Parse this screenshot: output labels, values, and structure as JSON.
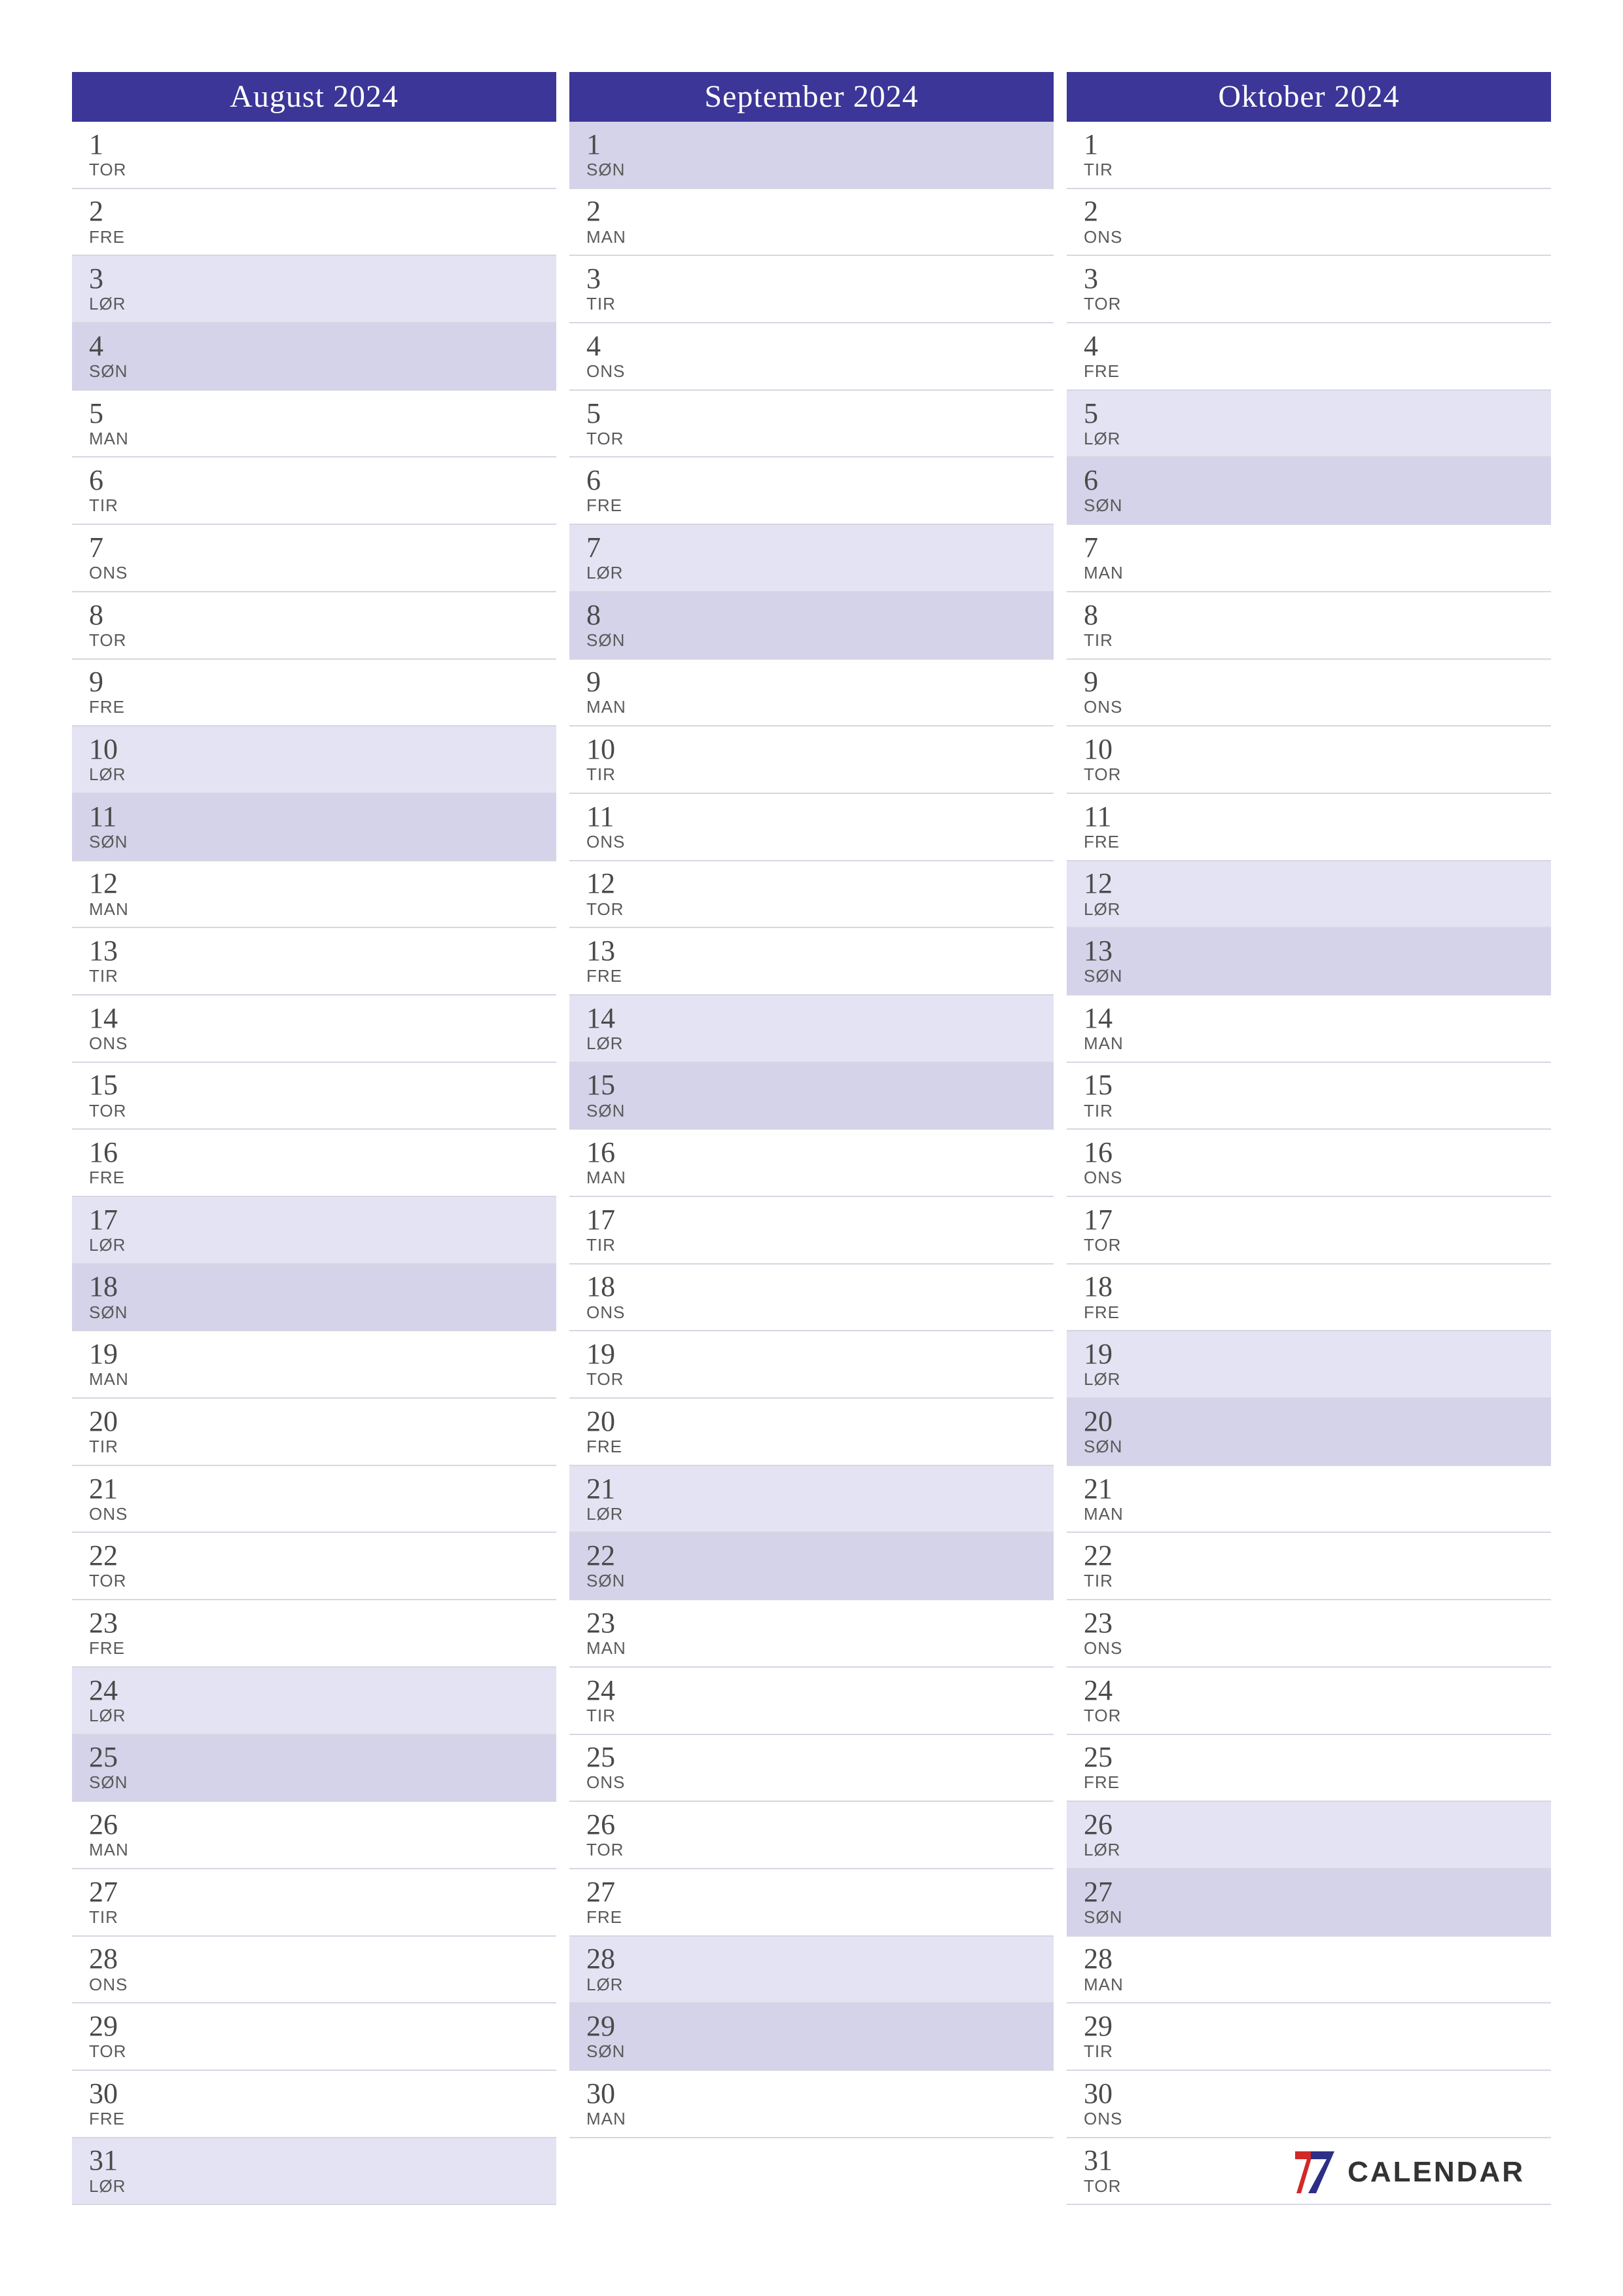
{
  "brand": {
    "word": "CALENDAR"
  },
  "weekday_names": {
    "mon": "MAN",
    "tue": "TIR",
    "wed": "ONS",
    "thu": "TOR",
    "fri": "FRE",
    "sat": "LØR",
    "sun": "SØN"
  },
  "months": [
    {
      "title": "August 2024",
      "first_weekday": "thu",
      "num_days": 31
    },
    {
      "title": "September 2024",
      "first_weekday": "sun",
      "num_days": 30
    },
    {
      "title": "Oktober 2024",
      "first_weekday": "tue",
      "num_days": 31
    }
  ]
}
